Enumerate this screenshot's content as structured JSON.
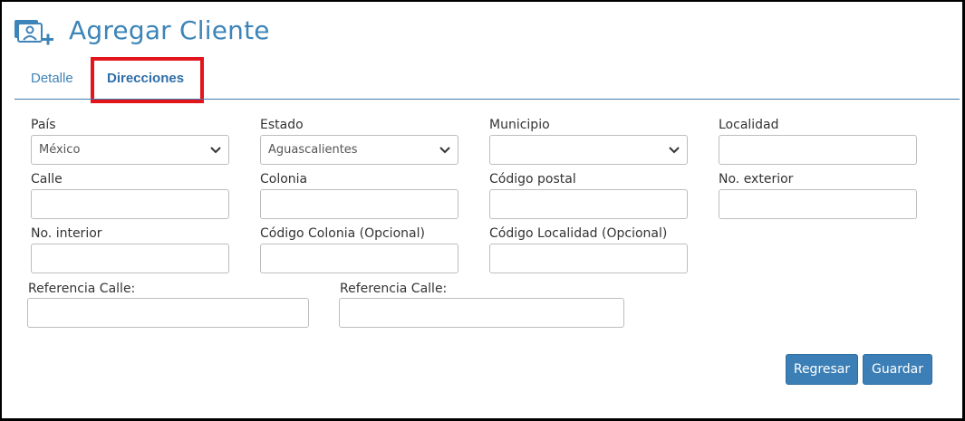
{
  "header": {
    "title": "Agregar Cliente",
    "icon": "add-contact-icon"
  },
  "tabs": [
    {
      "label": "Detalle",
      "active": false
    },
    {
      "label": "Direcciones",
      "active": true
    }
  ],
  "highlight_color": "#e3141c",
  "accent_color": "#3d84b8",
  "form": {
    "pais": {
      "label": "País",
      "value": "México"
    },
    "estado": {
      "label": "Estado",
      "value": "Aguascalientes"
    },
    "municipio": {
      "label": "Municipio",
      "value": ""
    },
    "localidad": {
      "label": "Localidad",
      "value": ""
    },
    "calle": {
      "label": "Calle",
      "value": ""
    },
    "colonia": {
      "label": "Colonia",
      "value": ""
    },
    "codigo_postal": {
      "label": "Código postal",
      "value": ""
    },
    "no_exterior": {
      "label": "No. exterior",
      "value": ""
    },
    "no_interior": {
      "label": "No. interior",
      "value": ""
    },
    "codigo_colonia": {
      "label": "Código Colonia (Opcional)",
      "value": ""
    },
    "codigo_localidad": {
      "label": "Código Localidad (Opcional)",
      "value": ""
    },
    "referencia_calle_1": {
      "label": "Referencia Calle:",
      "value": ""
    },
    "referencia_calle_2": {
      "label": "Referencia Calle:",
      "value": ""
    }
  },
  "buttons": {
    "regresar": "Regresar",
    "guardar": "Guardar"
  }
}
